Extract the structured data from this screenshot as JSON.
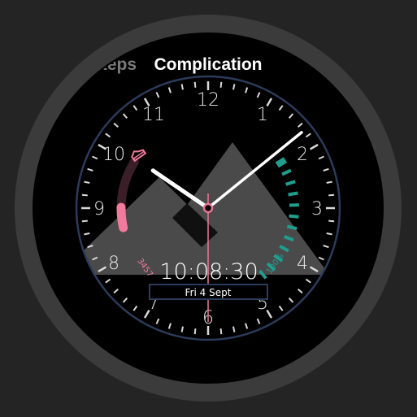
{
  "tabs": [
    {
      "label": "Steps",
      "active": false
    },
    {
      "label": "Complication",
      "active": true
    }
  ],
  "dial": {
    "hour_numerals": [
      "12",
      "1",
      "2",
      "3",
      "4",
      "5",
      "6",
      "7",
      "8",
      "9",
      "10",
      "11"
    ],
    "digital_time": "10:08:30",
    "date": "Fri 4 Sept",
    "ring_color": "#2b3b5a",
    "numeral_color": "#e8e8e8"
  },
  "hands": {
    "hour": 10,
    "minute": 8,
    "second": 30,
    "hand_color": "#ffffff",
    "second_color": "#e87895"
  },
  "steps_complication": {
    "icon": "shoe-icon",
    "value": "3457",
    "progress": 0.3,
    "color": "#f27a9c",
    "track_color": "#3a1f29"
  },
  "battery_complication": {
    "icon": "battery-indicator",
    "value": "100%",
    "progress": 1.0,
    "color": "#1f9e8e"
  },
  "background": {
    "mountains_color": "#4a4a4a"
  }
}
